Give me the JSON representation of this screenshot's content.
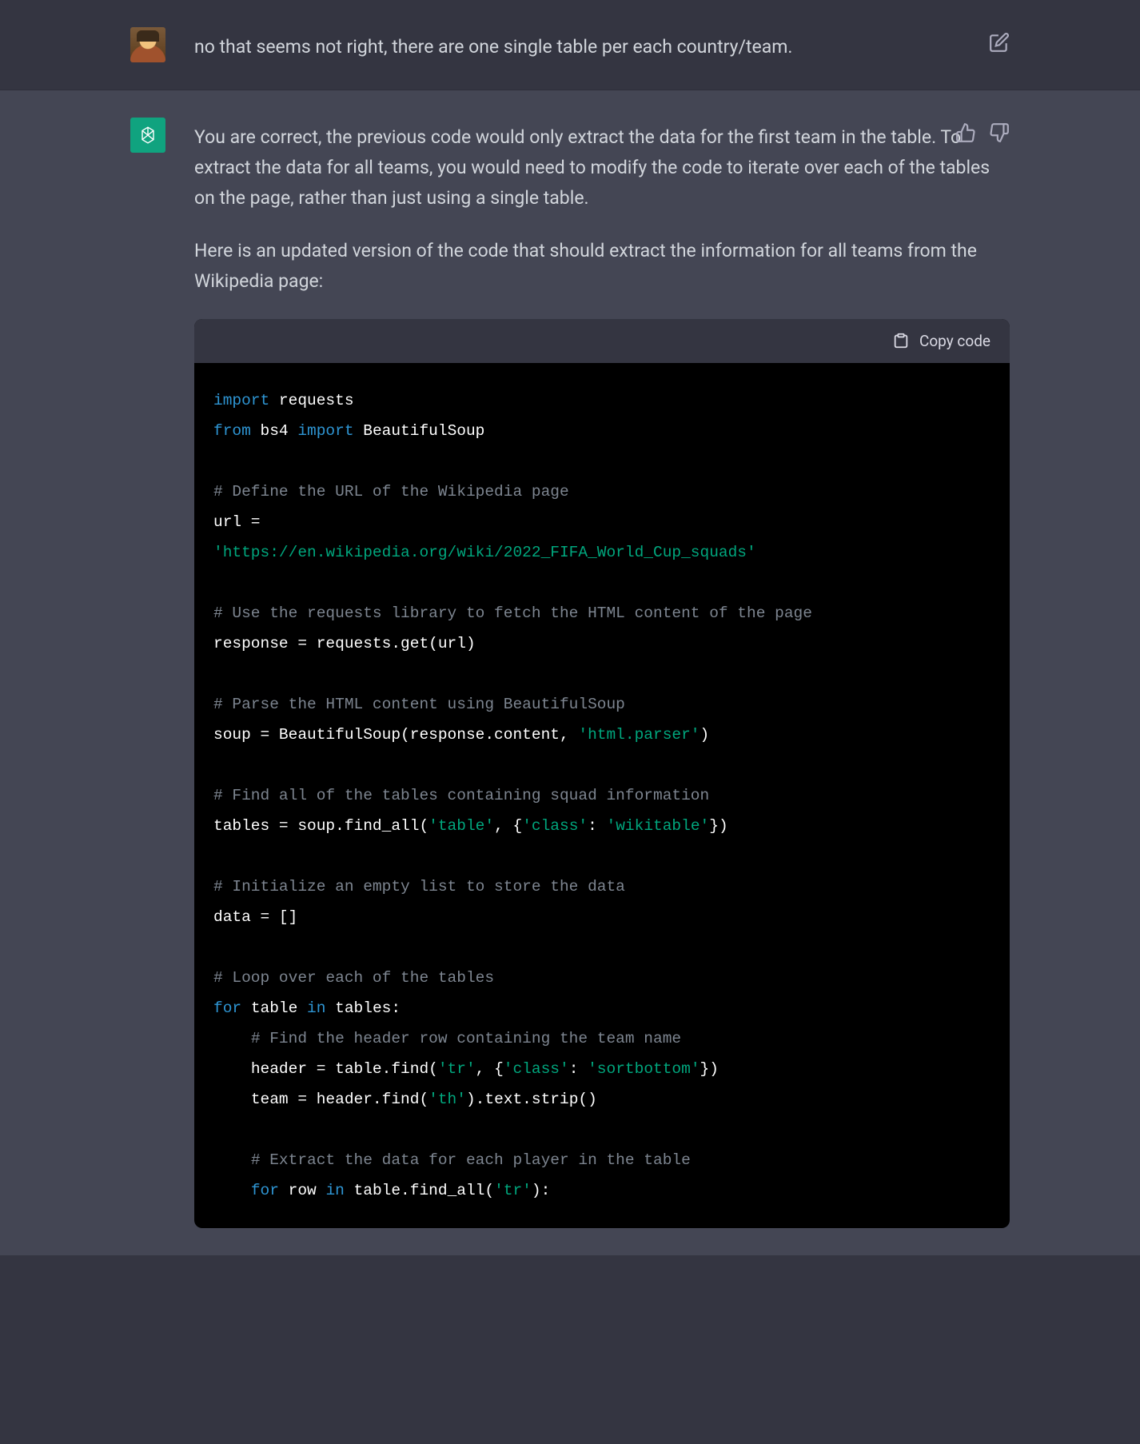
{
  "user_message": {
    "text": "no that seems not right, there are one single table per each country/team."
  },
  "assistant_message": {
    "paragraphs": [
      "You are correct, the previous code would only extract the data for the first team in the table. To extract the data for all teams, you would need to modify the code to iterate over each of the tables on the page, rather than just using a single table.",
      "Here is an updated version of the code that should extract the information for all teams from the Wikipedia page:"
    ]
  },
  "code_block": {
    "copy_label": "Copy code",
    "tokens": [
      [
        "kw",
        "import"
      ],
      [
        "sp",
        " "
      ],
      [
        "ident",
        "requests"
      ],
      [
        "nl"
      ],
      [
        "kw",
        "from"
      ],
      [
        "sp",
        " "
      ],
      [
        "ident",
        "bs4"
      ],
      [
        "sp",
        " "
      ],
      [
        "kw",
        "import"
      ],
      [
        "sp",
        " "
      ],
      [
        "ident",
        "BeautifulSoup"
      ],
      [
        "nl"
      ],
      [
        "nl"
      ],
      [
        "cm",
        "# Define the URL of the Wikipedia page"
      ],
      [
        "nl"
      ],
      [
        "ident",
        "url = "
      ],
      [
        "nl"
      ],
      [
        "str",
        "'https://en.wikipedia.org/wiki/2022_FIFA_World_Cup_squads'"
      ],
      [
        "nl"
      ],
      [
        "nl"
      ],
      [
        "cm",
        "# Use the requests library to fetch the HTML content of the page"
      ],
      [
        "nl"
      ],
      [
        "ident",
        "response = requests.get(url)"
      ],
      [
        "nl"
      ],
      [
        "nl"
      ],
      [
        "cm",
        "# Parse the HTML content using BeautifulSoup"
      ],
      [
        "nl"
      ],
      [
        "ident",
        "soup = BeautifulSoup(response.content, "
      ],
      [
        "str",
        "'html.parser'"
      ],
      [
        "ident",
        ")"
      ],
      [
        "nl"
      ],
      [
        "nl"
      ],
      [
        "cm",
        "# Find all of the tables containing squad information"
      ],
      [
        "nl"
      ],
      [
        "ident",
        "tables = soup.find_all("
      ],
      [
        "str",
        "'table'"
      ],
      [
        "ident",
        ", {"
      ],
      [
        "str",
        "'class'"
      ],
      [
        "ident",
        ": "
      ],
      [
        "str",
        "'wikitable'"
      ],
      [
        "ident",
        "})"
      ],
      [
        "nl"
      ],
      [
        "nl"
      ],
      [
        "cm",
        "# Initialize an empty list to store the data"
      ],
      [
        "nl"
      ],
      [
        "ident",
        "data = []"
      ],
      [
        "nl"
      ],
      [
        "nl"
      ],
      [
        "cm",
        "# Loop over each of the tables"
      ],
      [
        "nl"
      ],
      [
        "kw",
        "for"
      ],
      [
        "sp",
        " "
      ],
      [
        "ident",
        "table"
      ],
      [
        "sp",
        " "
      ],
      [
        "kw",
        "in"
      ],
      [
        "sp",
        " "
      ],
      [
        "ident",
        "tables:"
      ],
      [
        "nl"
      ],
      [
        "sp",
        "    "
      ],
      [
        "cm",
        "# Find the header row containing the team name"
      ],
      [
        "nl"
      ],
      [
        "sp",
        "    "
      ],
      [
        "ident",
        "header = table.find("
      ],
      [
        "str",
        "'tr'"
      ],
      [
        "ident",
        ", {"
      ],
      [
        "str",
        "'class'"
      ],
      [
        "ident",
        ": "
      ],
      [
        "str",
        "'sortbottom'"
      ],
      [
        "ident",
        "})"
      ],
      [
        "nl"
      ],
      [
        "sp",
        "    "
      ],
      [
        "ident",
        "team = header.find("
      ],
      [
        "str",
        "'th'"
      ],
      [
        "ident",
        ").text.strip()"
      ],
      [
        "nl"
      ],
      [
        "nl"
      ],
      [
        "sp",
        "    "
      ],
      [
        "cm",
        "# Extract the data for each player in the table"
      ],
      [
        "nl"
      ],
      [
        "sp",
        "    "
      ],
      [
        "kw",
        "for"
      ],
      [
        "sp",
        " "
      ],
      [
        "ident",
        "row"
      ],
      [
        "sp",
        " "
      ],
      [
        "kw",
        "in"
      ],
      [
        "sp",
        " "
      ],
      [
        "ident",
        "table.find_all("
      ],
      [
        "str",
        "'tr'"
      ],
      [
        "ident",
        "):"
      ]
    ]
  },
  "icons": {
    "edit": "edit-icon",
    "thumbs_up": "thumbs-up-icon",
    "thumbs_down": "thumbs-down-icon",
    "clipboard": "clipboard-icon"
  }
}
